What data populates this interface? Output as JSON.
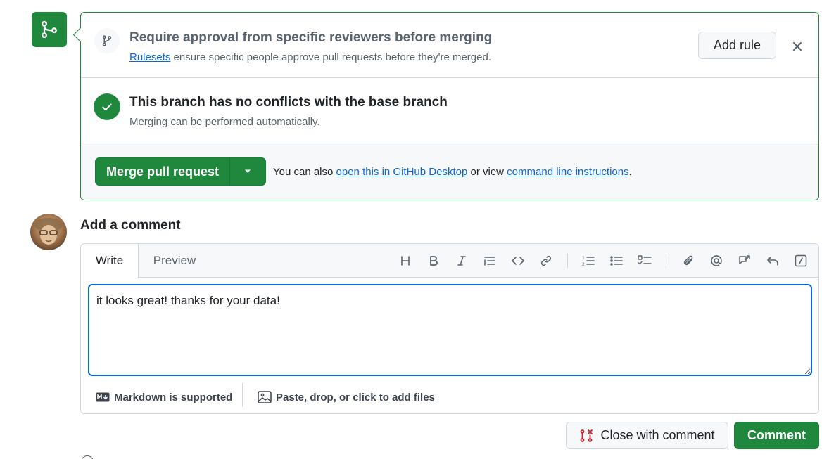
{
  "merge_box": {
    "approval": {
      "title": "Require approval from specific reviewers before merging",
      "link_text": "Rulesets",
      "subtitle_rest": " ensure specific people approve pull requests before they're merged.",
      "add_rule_label": "Add rule",
      "close_glyph": "✕"
    },
    "conflicts": {
      "title": "This branch has no conflicts with the base branch",
      "subtitle": "Merging can be performed automatically."
    },
    "merge": {
      "button_label": "Merge pull request",
      "note_prefix": "You can also ",
      "desktop_link": "open this in GitHub Desktop",
      "note_middle": " or view ",
      "cli_link": "command line instructions",
      "note_suffix": "."
    }
  },
  "comment": {
    "heading": "Add a comment",
    "tabs": {
      "write": "Write",
      "preview": "Preview"
    },
    "toolbar": [
      "heading-icon",
      "bold-icon",
      "italic-icon",
      "quote-icon",
      "code-icon",
      "link-icon",
      "ordered-list-icon",
      "unordered-list-icon",
      "task-list-icon",
      "attach-icon",
      "mention-icon",
      "reference-icon",
      "saved-reply-icon",
      "slash-command-icon"
    ],
    "text": "it looks great! thanks for your data!",
    "markdown_note": "Markdown is supported",
    "files_note": "Paste, drop, or click to add files"
  },
  "actions": {
    "close_with_comment": "Close with comment",
    "comment": "Comment"
  },
  "colors": {
    "green": "#1f883d",
    "link": "#0969da",
    "muted": "#59636e",
    "close_icon_red": "#cf222e"
  }
}
